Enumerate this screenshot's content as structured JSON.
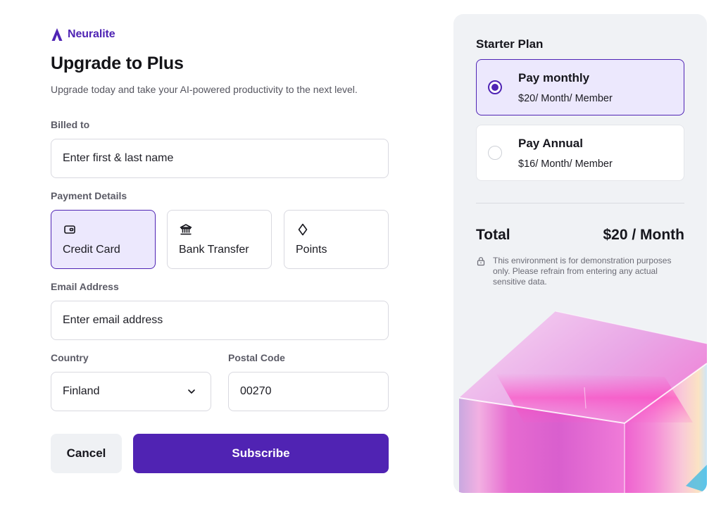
{
  "brand": {
    "name": "Neuralite",
    "icon": "neuralite-logo-icon",
    "color": "#4f24b4"
  },
  "page": {
    "title": "Upgrade to Plus",
    "subtitle": "Upgrade today and take your AI-powered productivity to the next level."
  },
  "form": {
    "billed_to": {
      "label": "Billed to",
      "placeholder": "Enter first & last name",
      "value": ""
    },
    "payment": {
      "label": "Payment Details",
      "options": [
        {
          "label": "Credit Card",
          "icon": "wallet-icon",
          "selected": true
        },
        {
          "label": "Bank Transfer",
          "icon": "bank-icon",
          "selected": false
        },
        {
          "label": "Points",
          "icon": "diamond-icon",
          "selected": false
        }
      ]
    },
    "email": {
      "label": "Email Address",
      "placeholder": "Enter email address",
      "value": ""
    },
    "country": {
      "label": "Country",
      "value": "Finland"
    },
    "postal": {
      "label": "Postal Code",
      "value": "00270"
    },
    "cancel_label": "Cancel",
    "subscribe_label": "Subscribe"
  },
  "summary": {
    "plan_title": "Starter Plan",
    "plans": [
      {
        "name": "Pay monthly",
        "price": "$20/ Month/ Member",
        "selected": true
      },
      {
        "name": "Pay Annual",
        "price": "$16/ Month/ Member",
        "selected": false
      }
    ],
    "total_label": "Total",
    "total_value": "$20 / Month",
    "notice": "This environment is for demonstration purposes only. Please refrain from entering any actual sensitive data."
  },
  "colors": {
    "accent": "#5023b3",
    "selected_bg": "#ece8fd",
    "panel_bg": "#f0f2f5",
    "cancel_bg": "#eff1f4"
  }
}
